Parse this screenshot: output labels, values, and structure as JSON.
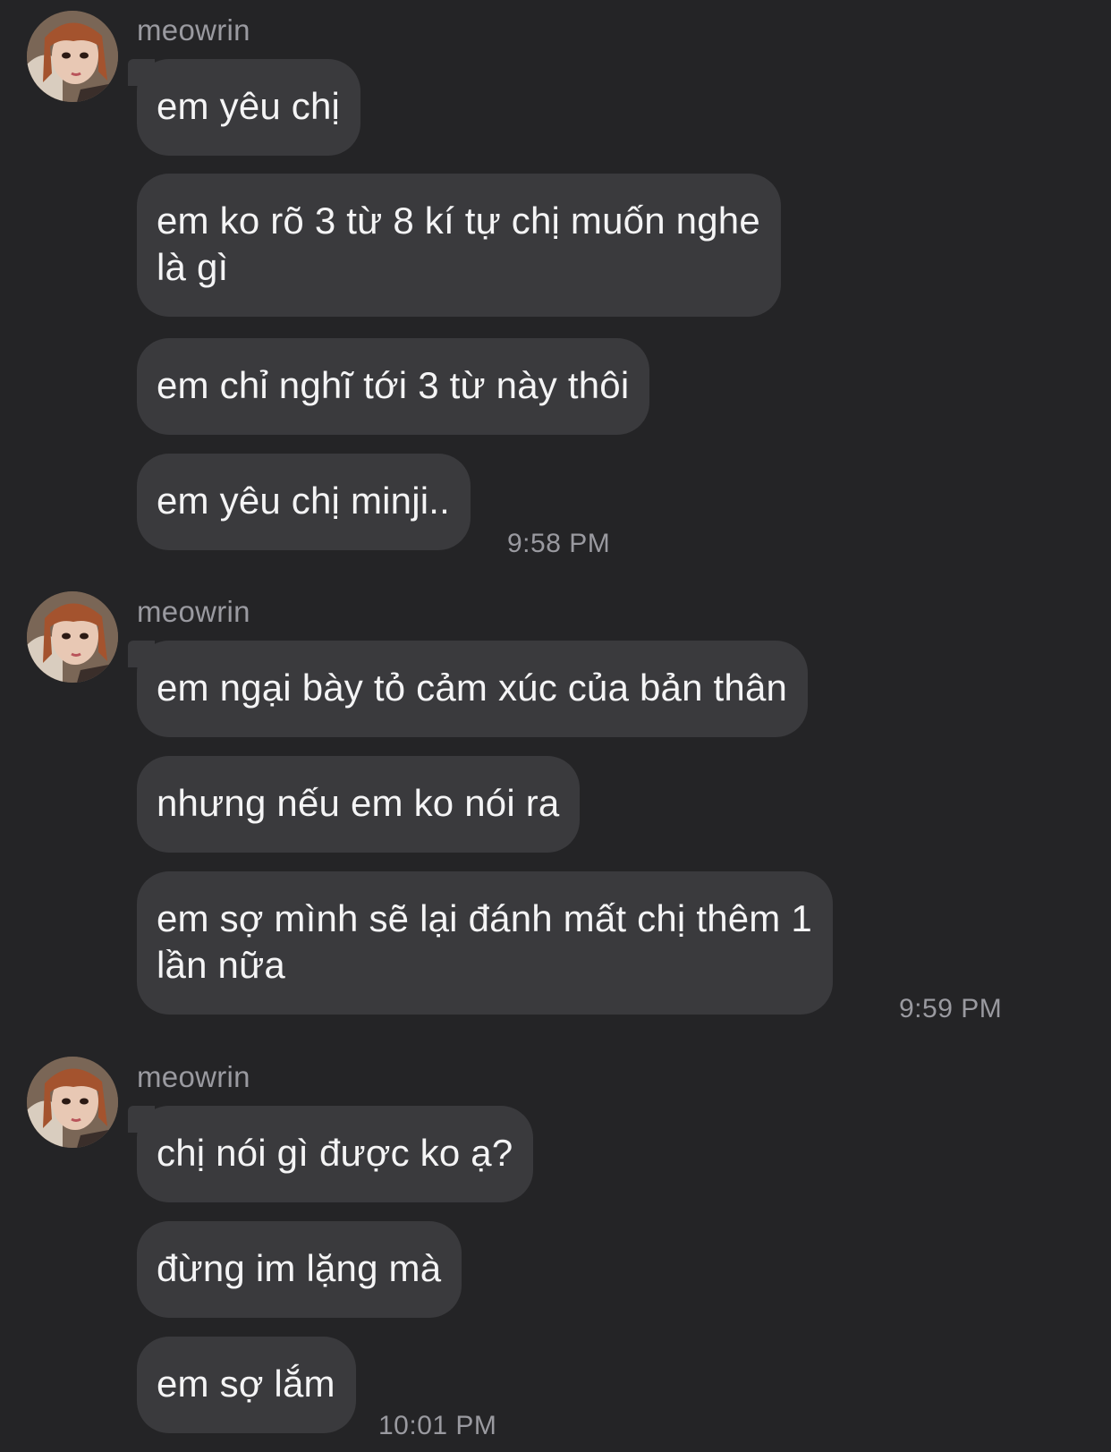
{
  "groups": [
    {
      "sender": "meowrin",
      "messages": [
        "em yêu chị",
        "em ko rõ 3 từ 8 kí tự chị muốn nghe\nlà gì",
        "em chỉ nghĩ tới 3 từ này thôi",
        "em yêu chị minji.."
      ],
      "time": "9:58 PM"
    },
    {
      "sender": "meowrin",
      "messages": [
        "em ngại bày tỏ cảm xúc của bản thân",
        "nhưng nếu em ko nói ra",
        "em sợ mình sẽ lại đánh mất chị thêm 1\nlần nữa"
      ],
      "time": "9:59 PM"
    },
    {
      "sender": "meowrin",
      "messages": [
        "chị nói gì được ko ạ?",
        "đừng im lặng mà",
        "em sợ lắm"
      ],
      "time": "10:01 PM"
    }
  ],
  "colors": {
    "background": "#242426",
    "bubble": "#3a3a3d",
    "text": "#f4f4f5",
    "meta": "#9a9aa0"
  },
  "icons": {
    "avatar": "avatar-photo"
  }
}
